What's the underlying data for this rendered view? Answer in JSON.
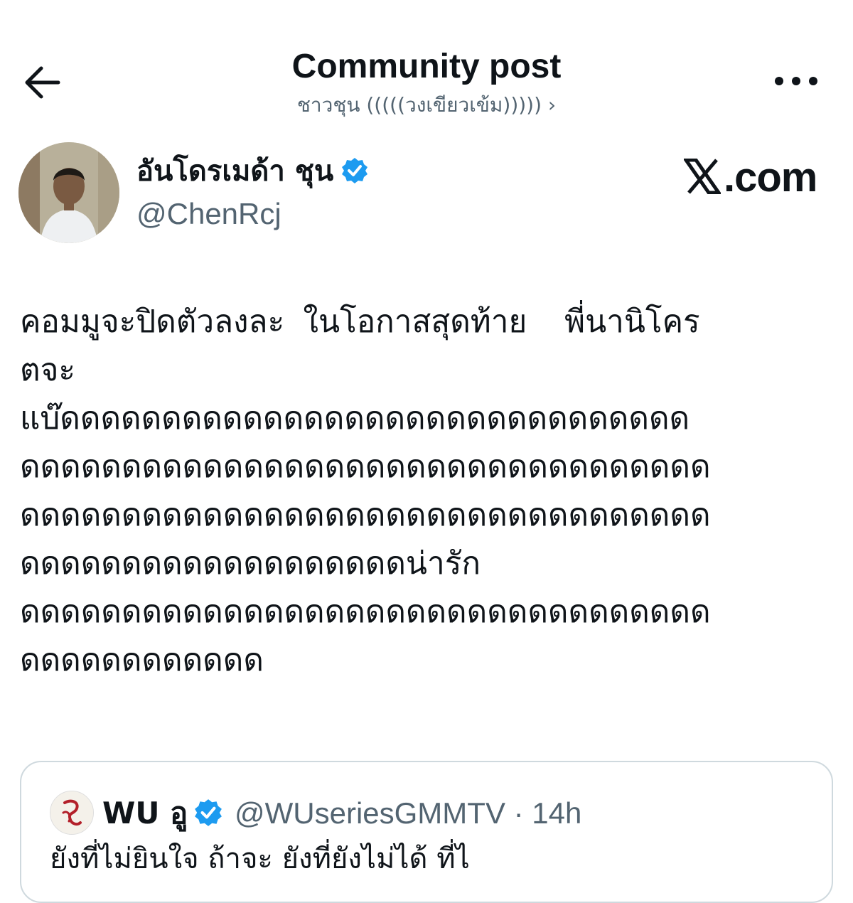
{
  "header": {
    "title": "Community post",
    "community_name": "ชาวชุน (((((วงเขียวเข้ม)))))",
    "chevron": "›",
    "back_icon": "arrow-left-icon",
    "more_icon": "more-dots-icon"
  },
  "author": {
    "display_name": "อันโดรเมด้า ชุน",
    "handle": "@ChenRcj",
    "verified": true
  },
  "watermark": {
    "suffix": ".com"
  },
  "post": {
    "text": "คอมมูจะปิดตัวลงละ ในโอกาสสุดท้าย  พี่นานิโคร\nตจะ\nแบ๊ดดดดดดดดดดดดดดดดดดดดดดดดดดดดดดด\nดดดดดดดดดดดดดดดดดดดดดดดดดดดดดดดดดด\nดดดดดดดดดดดดดดดดดดดดดดดดดดดดดดดดดด\nดดดดดดดดดดดดดดดดดดดน่ารัก\nดดดดดดดดดดดดดดดดดดดดดดดดดดดดดดดดดด\nดดดดดดดดดดดด"
  },
  "quoted_post": {
    "display_name": "WU อู",
    "handle": "@WUseriesGMMTV",
    "separator": "·",
    "time": "14h",
    "text": "ยังที่ไม่ยินใจ ถ้าจะ ยังที่ยังไม่ได้ ที่ไ"
  },
  "colors": {
    "verified_blue": "#1d9bf0",
    "secondary_text": "#536471",
    "border": "#cfd9de"
  }
}
